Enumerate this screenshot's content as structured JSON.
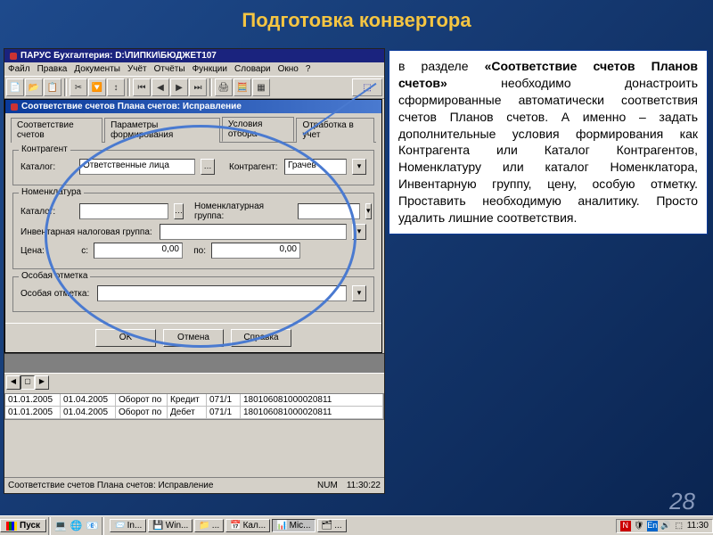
{
  "slide": {
    "title": "Подготовка конвертора",
    "page": "28"
  },
  "app": {
    "title": "ПАРУС Бухгалтерия: D:\\ЛИПКИ\\БЮДЖЕТ107",
    "menu": [
      "Файл",
      "Правка",
      "Документы",
      "Учёт",
      "Отчёты",
      "Функции",
      "Словари",
      "Окно",
      "?"
    ]
  },
  "dialog": {
    "title": "Соответствие счетов Плана счетов: Исправление",
    "tabs": [
      "Соответствие счетов",
      "Параметры формирования",
      "Условия отбора",
      "Отработка в учет"
    ],
    "active_tab": 2,
    "kontragent": {
      "legend": "Контрагент",
      "katalog_lbl": "Каталог:",
      "katalog_val": "Ответственные лица",
      "kontragent_lbl": "Контрагент:",
      "kontragent_val": "Грачев"
    },
    "nomen": {
      "legend": "Номенклатура",
      "katalog_lbl": "Каталог:",
      "katalog_val": "",
      "group_lbl": "Номенклатурная группа:",
      "group_val": "",
      "inv_lbl": "Инвентарная налоговая группа:",
      "inv_val": "",
      "price_lbl": "Цена:",
      "from_lbl": "с:",
      "from_val": "0,00",
      "to_lbl": "по:",
      "to_val": "0,00"
    },
    "mark": {
      "legend": "Особая отметка",
      "lbl": "Особая отметка:",
      "val": ""
    },
    "buttons": {
      "ok": "OK",
      "cancel": "Отмена",
      "help": "Справка"
    }
  },
  "table": {
    "rows": [
      [
        "01.01.2005",
        "01.04.2005",
        "Оборот по",
        "Кредит",
        "071/1",
        "180106081000020811"
      ],
      [
        "01.01.2005",
        "01.04.2005",
        "Оборот по",
        "Дебет",
        "071/1",
        "180106081000020811"
      ]
    ]
  },
  "statusbar": {
    "text": "Соответствие счетов Плана счетов: Исправление",
    "num": "NUM",
    "time": "11:30:22"
  },
  "taskbar": {
    "start": "Пуск",
    "tasks": [
      {
        "icon": "📨",
        "label": "In..."
      },
      {
        "icon": "💾",
        "label": "Win..."
      },
      {
        "icon": "📁",
        "label": "..."
      },
      {
        "icon": "📅",
        "label": "Кал..."
      },
      {
        "icon": "📊",
        "label": "Mic...",
        "active": true
      },
      {
        "icon": "🗂",
        "label": "..."
      }
    ],
    "clock": "11:30"
  },
  "textbox": {
    "bold1": "«Соответствие счетов Планов счетов»",
    "pre": "в разделе ",
    "post": " необходимо донастроить сформированные автоматически соответствия счетов Планов счетов. А именно – задать дополнительные условия формирования как Контрагента или Каталог Контрагентов, Номенклатуру или каталог Номенклатора, Инвентарную группу, цену, особую отметку. Проставить необходимую аналитику. Просто удалить лишние соответствия."
  }
}
